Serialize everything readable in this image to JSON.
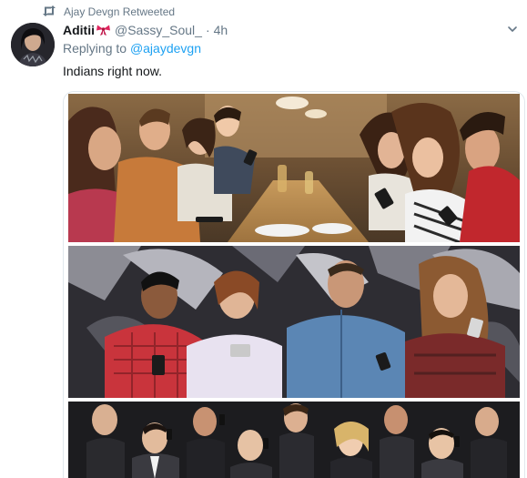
{
  "retweet": {
    "icon": "retweet-icon",
    "label": "Ajay Devgn Retweeted"
  },
  "tweet": {
    "avatar_icon": "avatar",
    "display_name": "Aditii",
    "name_emoji": "ribbon-bow-icon",
    "handle": "@Sassy_Soul_",
    "separator": "·",
    "time": "4h",
    "reply_prefix": "Replying to ",
    "reply_to": "@ajaydevgn",
    "text": "Indians right now.",
    "menu_icon": "chevron-down-icon"
  },
  "media": {
    "images": [
      "photo-people-at-dinner-table-on-phones",
      "photo-four-people-on-phones-graffiti-wall",
      "photo-business-crowd-on-phones"
    ]
  },
  "colors": {
    "secondary_text": "#657786",
    "link": "#1da1f2",
    "primary_text": "#14171a",
    "border": "#e1e8ed",
    "ribbon": "#e0245e"
  }
}
